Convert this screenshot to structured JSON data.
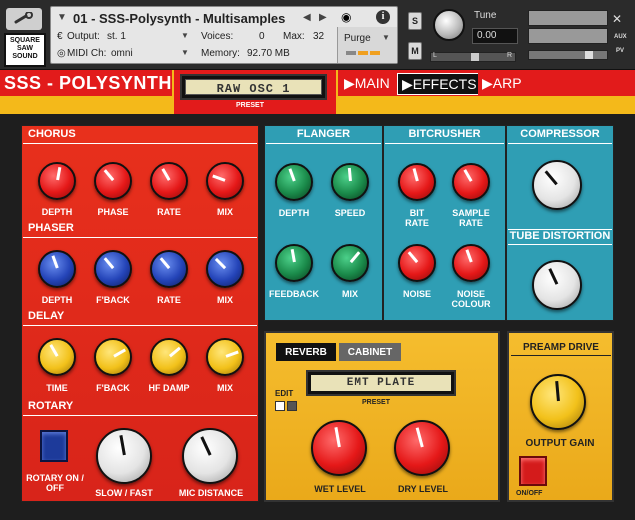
{
  "header": {
    "instrument_name": "01 - SSS-Polysynth - Multisamples",
    "output_label": "Output:",
    "output_value": "st. 1",
    "voices_label": "Voices:",
    "voices_value": "0",
    "max_label": "Max:",
    "max_value": "32",
    "midi_label": "MIDI Ch:",
    "midi_value": "omni",
    "memory_label": "Memory:",
    "memory_value": "92.70 MB",
    "purge_label": "Purge",
    "s_label": "S",
    "m_label": "M",
    "tune_label": "Tune",
    "tune_value": "0.00",
    "l_label": "L",
    "r_label": "R",
    "aux_label": "AUX",
    "pv_label": "PV",
    "logo_text": "SQUARE SAW SOUND"
  },
  "titlebar": {
    "title": "SSS - POLYSYNTH",
    "preset_value": "RAW OSC 1",
    "preset_label": "PRESET",
    "tabs": [
      {
        "label": "▶MAIN"
      },
      {
        "label": "▶EFFECTS"
      },
      {
        "label": "▶ARP"
      }
    ]
  },
  "chorus": {
    "title": "CHORUS",
    "knobs": [
      "DEPTH",
      "PHASE",
      "RATE",
      "MIX"
    ]
  },
  "phaser": {
    "title": "PHASER",
    "knobs": [
      "DEPTH",
      "F'BACK",
      "RATE",
      "MIX"
    ]
  },
  "delay": {
    "title": "DELAY",
    "knobs": [
      "TIME",
      "F'BACK",
      "HF DAMP",
      "MIX"
    ]
  },
  "rotary": {
    "title": "ROTARY",
    "switch_label": "ROTARY ON / OFF",
    "knobs": [
      "SLOW / FAST",
      "MIC DISTANCE"
    ]
  },
  "flanger": {
    "title": "FLANGER",
    "knobs": [
      "DEPTH",
      "SPEED",
      "FEEDBACK",
      "MIX"
    ]
  },
  "bitcrusher": {
    "title": "BITCRUSHER",
    "knobs": [
      "BIT RATE",
      "SAMPLE RATE",
      "NOISE",
      "NOISE COLOUR"
    ]
  },
  "compressor": {
    "title": "COMPRESSOR"
  },
  "tube": {
    "title": "TUBE DISTORTION"
  },
  "reverb": {
    "tabs": [
      "REVERB",
      "CABINET"
    ],
    "edit_label": "EDIT",
    "preset_value": "EMT PLATE",
    "preset_label": "PRESET",
    "knobs": [
      "WET LEVEL",
      "DRY LEVEL"
    ]
  },
  "preamp": {
    "title": "PREAMP DRIVE",
    "knob": "OUTPUT GAIN",
    "switch_label": "ON/OFF"
  },
  "colors": {
    "red": "#e21b1b",
    "yellow": "#f4b91a",
    "teal": "#2f9eb4",
    "reverb_bg": "#f2b322"
  }
}
